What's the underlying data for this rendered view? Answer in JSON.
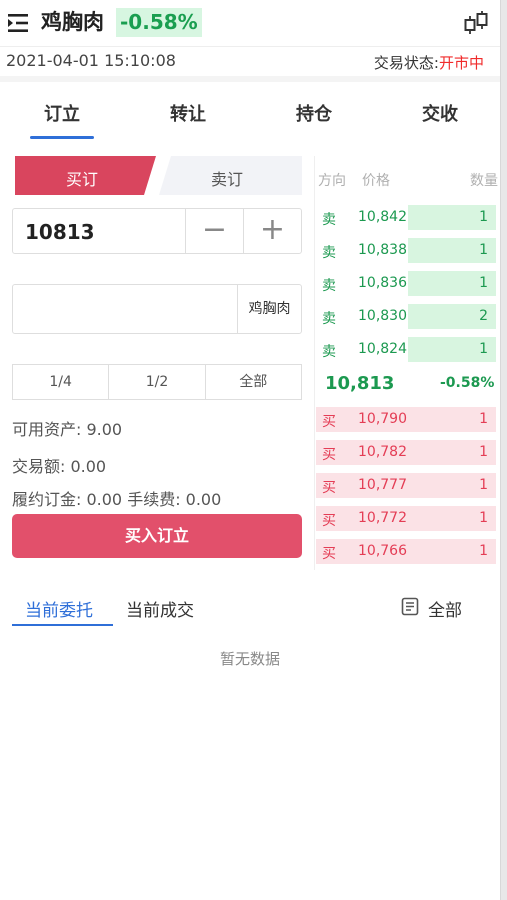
{
  "header": {
    "title": "鸡胸肉",
    "change_pct": "-0.58%",
    "datetime": "2021-04-01 15:10:08",
    "status_label": "交易状态:",
    "status_value": "开市中"
  },
  "tabs": [
    "订立",
    "转让",
    "持仓",
    "交收"
  ],
  "order_form": {
    "buy_label": "买订",
    "sell_label": "卖订",
    "quantity": "10813",
    "product_name": "鸡胸肉",
    "ratios": [
      "1/4",
      "1/2",
      "全部"
    ],
    "available": "可用资产: 9.00",
    "trade_amount": "交易额: 0.00",
    "margin_fee": "履约订金: 0.00 手续费: 0.00",
    "submit_label": "买入订立"
  },
  "order_book": {
    "headers": {
      "side": "方向",
      "price": "价格",
      "qty": "数量"
    },
    "asks": [
      {
        "side": "卖",
        "price": "10,842",
        "qty": "1"
      },
      {
        "side": "卖",
        "price": "10,838",
        "qty": "1"
      },
      {
        "side": "卖",
        "price": "10,836",
        "qty": "1"
      },
      {
        "side": "卖",
        "price": "10,830",
        "qty": "2"
      },
      {
        "side": "卖",
        "price": "10,824",
        "qty": "1"
      }
    ],
    "last_price": "10,813",
    "last_change": "-0.58%",
    "bids": [
      {
        "side": "买",
        "price": "10,790",
        "qty": "1"
      },
      {
        "side": "买",
        "price": "10,782",
        "qty": "1"
      },
      {
        "side": "买",
        "price": "10,777",
        "qty": "1"
      },
      {
        "side": "买",
        "price": "10,772",
        "qty": "1"
      },
      {
        "side": "买",
        "price": "10,766",
        "qty": "1"
      }
    ]
  },
  "bottom": {
    "tab_current_orders": "当前委托",
    "tab_current_deals": "当前成交",
    "all_label": "全部",
    "empty_text": "暂无数据"
  },
  "colors": {
    "up_red": "#e2506b",
    "down_green": "#1c9950",
    "accent_blue": "#2f6fd8"
  },
  "icons": [
    "menu-icon",
    "kline-icon",
    "minus-icon",
    "plus-icon",
    "document-icon"
  ]
}
